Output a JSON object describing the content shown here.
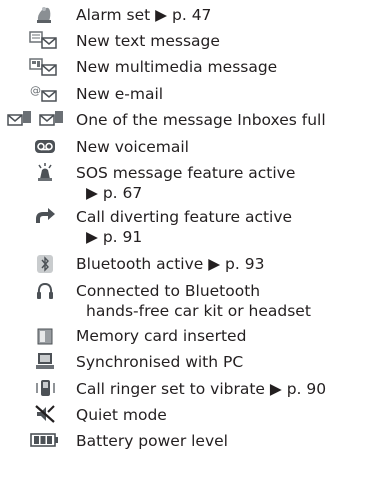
{
  "items": [
    {
      "icon": "alarm-icon",
      "lines": [
        "Alarm set ▶ p. 47"
      ]
    },
    {
      "icon": "text-message-icon",
      "lines": [
        "New text message"
      ]
    },
    {
      "icon": "multimedia-message-icon",
      "lines": [
        "New multimedia message"
      ]
    },
    {
      "icon": "email-icon",
      "lines": [
        "New e-mail"
      ]
    },
    {
      "icon": "inbox-full-icon",
      "lines": [
        "One of the message Inboxes full"
      ]
    },
    {
      "icon": "voicemail-icon",
      "lines": [
        "New voicemail"
      ]
    },
    {
      "icon": "sos-icon",
      "lines": [
        "SOS message feature active",
        "▶ p. 67"
      ]
    },
    {
      "icon": "call-divert-icon",
      "lines": [
        "Call diverting feature active",
        "▶ p. 91"
      ]
    },
    {
      "icon": "bluetooth-icon",
      "lines": [
        "Bluetooth active ▶ p. 93"
      ]
    },
    {
      "icon": "headset-icon",
      "lines": [
        "Connected to Bluetooth",
        "hands-free car kit or headset"
      ]
    },
    {
      "icon": "memory-card-icon",
      "lines": [
        "Memory card inserted"
      ]
    },
    {
      "icon": "pc-sync-icon",
      "lines": [
        "Synchronised with PC"
      ]
    },
    {
      "icon": "vibrate-icon",
      "lines": [
        "Call ringer set to vibrate ▶ p. 90"
      ]
    },
    {
      "icon": "quiet-mode-icon",
      "lines": [
        "Quiet mode"
      ]
    },
    {
      "icon": "battery-icon",
      "lines": [
        "Battery power level"
      ]
    }
  ]
}
